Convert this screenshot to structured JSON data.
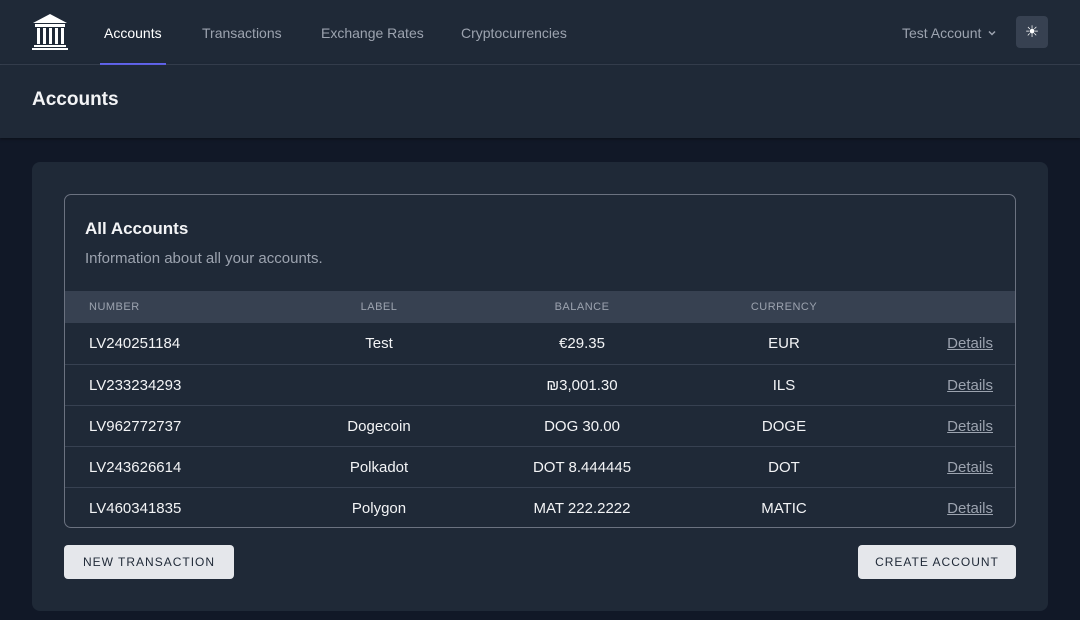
{
  "nav": {
    "links": [
      {
        "label": "Accounts",
        "active": true
      },
      {
        "label": "Transactions",
        "active": false
      },
      {
        "label": "Exchange Rates",
        "active": false
      },
      {
        "label": "Cryptocurrencies",
        "active": false
      }
    ],
    "user_label": "Test Account",
    "chevron_icon": "chevron-down-icon",
    "theme_icon": "sun-icon",
    "theme_glyph": "☀",
    "logo_icon": "bank-icon"
  },
  "page": {
    "title": "Accounts"
  },
  "card": {
    "title": "All Accounts",
    "subtitle": "Information about all your accounts."
  },
  "table": {
    "headers": {
      "number": "Number",
      "label": "Label",
      "balance": "Balance",
      "currency": "Currency"
    },
    "rows": [
      {
        "number": "LV240251184",
        "label": "Test",
        "balance": "€29.35",
        "currency": "EUR",
        "details": "Details"
      },
      {
        "number": "LV233234293",
        "label": "",
        "balance": "₪3,001.30",
        "currency": "ILS",
        "details": "Details"
      },
      {
        "number": "LV962772737",
        "label": "Dogecoin",
        "balance": "DOG 30.00",
        "currency": "DOGE",
        "details": "Details"
      },
      {
        "number": "LV243626614",
        "label": "Polkadot",
        "balance": "DOT 8.444445",
        "currency": "DOT",
        "details": "Details"
      },
      {
        "number": "LV460341835",
        "label": "Polygon",
        "balance": "MAT 222.2222",
        "currency": "MATIC",
        "details": "Details"
      }
    ]
  },
  "actions": {
    "new_transaction": "New Transaction",
    "create_account": "Create Account"
  },
  "colors": {
    "background": "#111827",
    "surface": "#1f2937",
    "accent": "#6366f1",
    "button_bg": "#e5e7eb"
  }
}
